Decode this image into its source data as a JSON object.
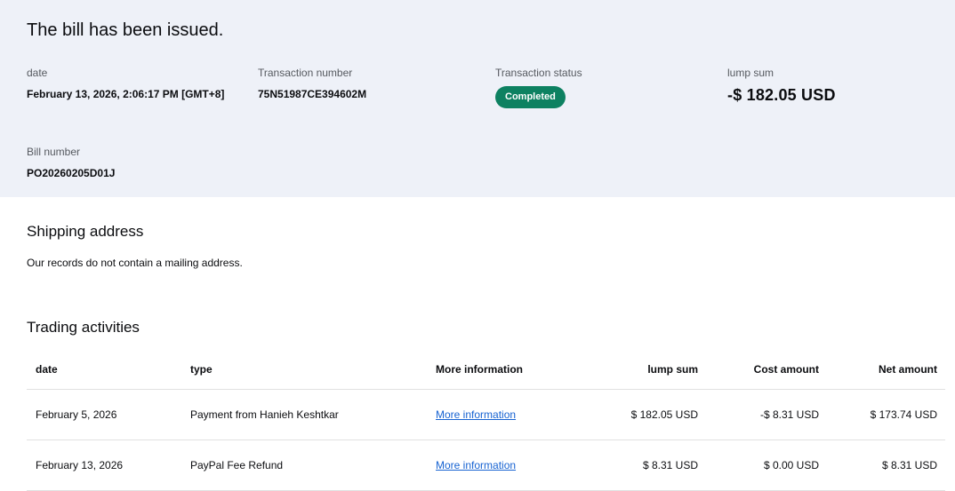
{
  "page": {
    "title": "The bill has been issued."
  },
  "summary": {
    "fields": [
      {
        "label": "date",
        "value": "February 13, 2026, 2:06:17 PM [GMT+8]"
      },
      {
        "label": "Transaction number",
        "value": "75N51987CE394602M"
      },
      {
        "label": "Transaction status",
        "value": "Completed"
      },
      {
        "label": "lump sum",
        "value": "-$ 182.05 USD"
      },
      {
        "label": "Bill number",
        "value": "PO20260205D01J"
      }
    ]
  },
  "shipping": {
    "heading": "Shipping address",
    "message": "Our records do not contain a mailing address."
  },
  "activities": {
    "heading": "Trading activities",
    "columns": [
      "date",
      "type",
      "More information",
      "lump sum",
      "Cost amount",
      "Net amount"
    ],
    "rows": [
      {
        "date": "February 5, 2026",
        "type": "Payment from Hanieh Keshtkar",
        "more": "More information",
        "lump_sum": "$ 182.05 USD",
        "cost": "-$ 8.31 USD",
        "net": "$ 173.74 USD"
      },
      {
        "date": "February 13, 2026",
        "type": "PayPal Fee Refund",
        "more": "More information",
        "lump_sum": "$ 8.31 USD",
        "cost": "$ 0.00 USD",
        "net": "$ 8.31 USD"
      }
    ]
  },
  "colors": {
    "band_background": "#eef1f8",
    "badge_green": "#0d8161",
    "link_blue": "#1763d2",
    "divider": "#e0e0e0",
    "label_gray": "#55595f",
    "text": "#0b0c0f"
  }
}
